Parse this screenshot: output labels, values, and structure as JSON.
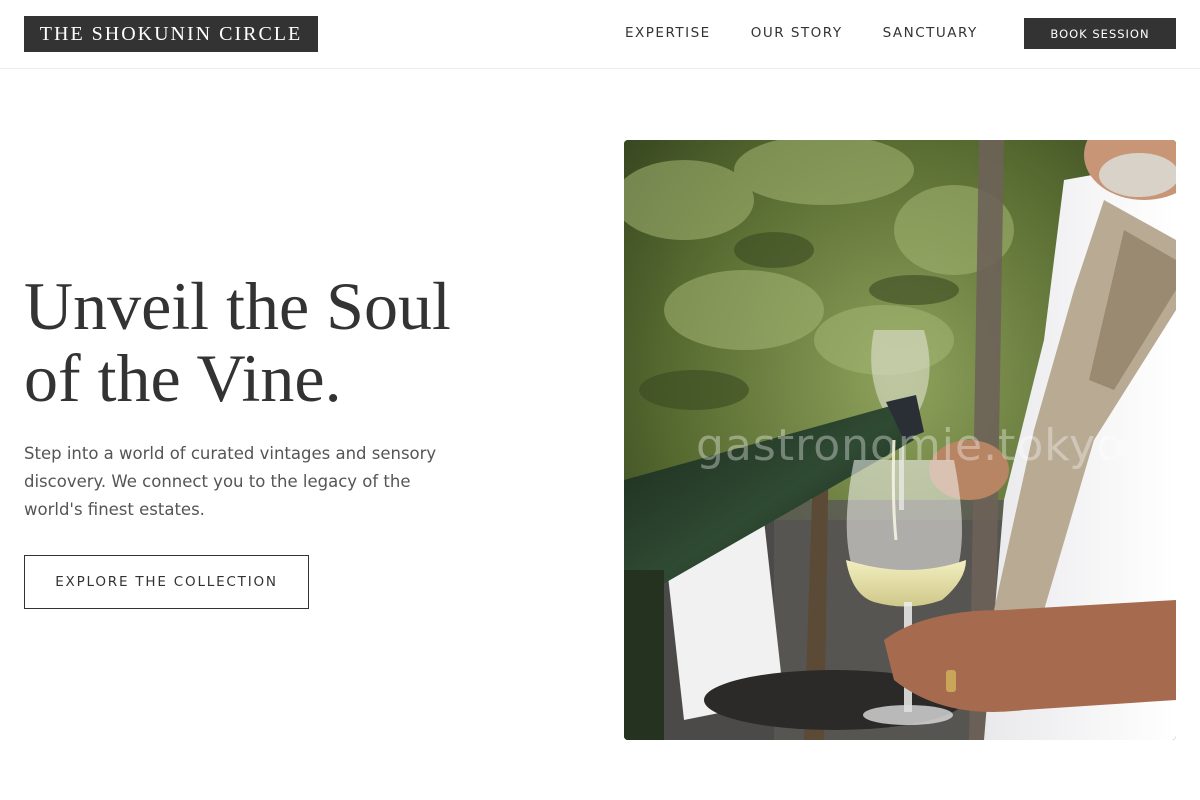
{
  "header": {
    "brand": "THE SHOKUNIN CIRCLE",
    "nav": [
      {
        "label": "EXPERTISE"
      },
      {
        "label": "OUR STORY"
      },
      {
        "label": "SANCTUARY"
      }
    ],
    "cta_label": "BOOK SESSION"
  },
  "hero": {
    "title_line1": "Unveil the Soul",
    "title_line2": "of the Vine.",
    "description": "Step into a world of curated vintages and sensory discovery. We connect you to the legacy of the world's finest estates.",
    "button_label": "EXPLORE THE COLLECTION"
  },
  "photo": {
    "watermark": "gastronomie.tokyo",
    "subject": "wine being poured into a glass outdoors"
  },
  "colors": {
    "dark": "#333333",
    "background": "#ffffff",
    "text_muted": "#555555"
  }
}
